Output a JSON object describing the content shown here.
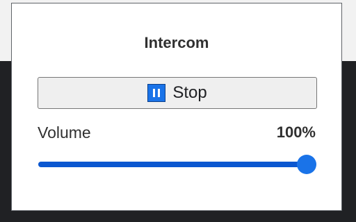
{
  "popup": {
    "title": "Intercom",
    "stop_button": {
      "label": "Stop",
      "icon": "pause-icon"
    },
    "volume": {
      "label": "Volume",
      "value_text": "100%",
      "level": 1.0
    }
  },
  "colors": {
    "accent": "#1a73e8",
    "slider_fill": "#0b57d0",
    "dark_background": "#202124"
  }
}
